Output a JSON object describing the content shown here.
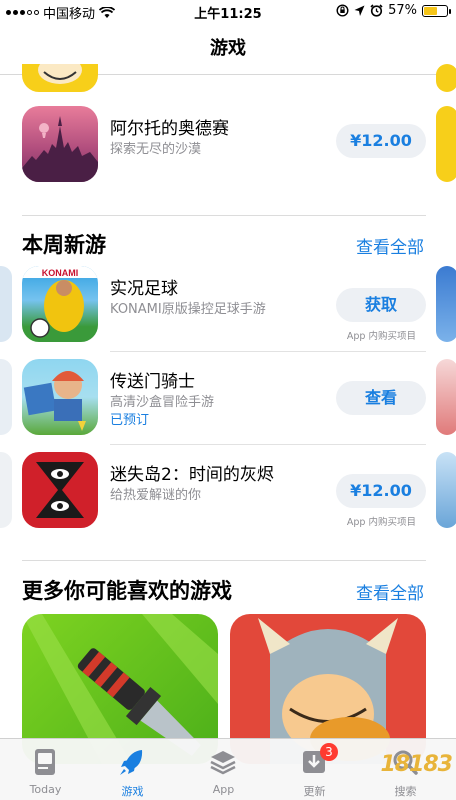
{
  "status_bar": {
    "carrier": "中国移动",
    "time": "上午11:25",
    "battery_percent": "57%",
    "battery_level": 0.57,
    "icons": [
      "signal-icon",
      "wifi-icon",
      "lock-rotation-icon",
      "location-icon",
      "alarm-icon",
      "battery-icon"
    ]
  },
  "nav": {
    "title": "游戏"
  },
  "featured_app": {
    "name": "阿尔托的奥德赛",
    "subtitle": "探索无尽的沙漠",
    "action": "¥12.00"
  },
  "section_new": {
    "title": "本周新游",
    "see_all": "查看全部",
    "apps": [
      {
        "name": "实况足球",
        "subtitle": "KONAMI原版操控足球手游",
        "extra": "",
        "action": "获取",
        "note": "App 内购买项目",
        "icon_text": "KONAMI"
      },
      {
        "name": "传送门骑士",
        "subtitle": "高清沙盒冒险手游",
        "extra": "已预订",
        "action": "查看",
        "note": ""
      },
      {
        "name": "迷失岛2：时间的灰烬",
        "subtitle": "给热爱解谜的你",
        "extra": "",
        "action": "¥12.00",
        "note": "App 内购买项目"
      }
    ]
  },
  "section_more": {
    "title": "更多你可能喜欢的游戏",
    "see_all": "查看全部"
  },
  "tab_bar": {
    "tabs": [
      {
        "label": "Today",
        "icon": "today-icon",
        "active": false
      },
      {
        "label": "游戏",
        "icon": "rocket-icon",
        "active": true
      },
      {
        "label": "App",
        "icon": "layers-icon",
        "active": false
      },
      {
        "label": "更新",
        "icon": "download-icon",
        "active": false,
        "badge": "3"
      },
      {
        "label": "搜索",
        "icon": "search-icon",
        "active": false
      }
    ]
  },
  "watermark": "18183",
  "colors": {
    "accent": "#1a7fe0",
    "badge": "#ff3b30",
    "battery": "#f5c518"
  }
}
